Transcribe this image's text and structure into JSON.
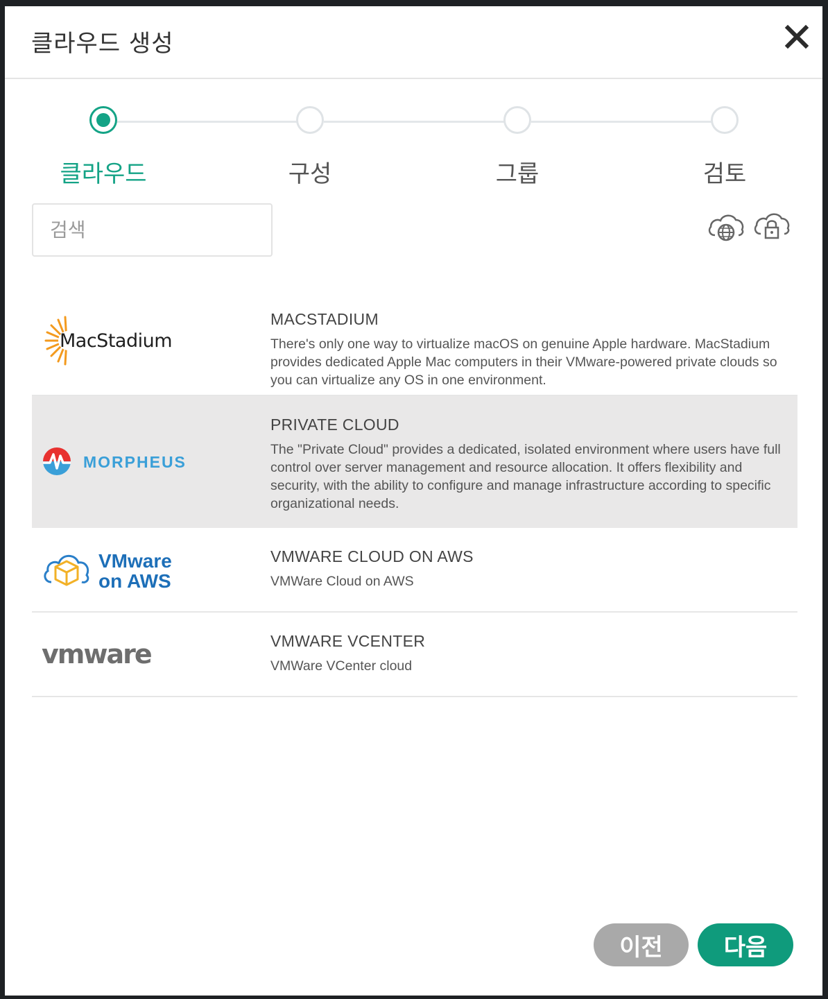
{
  "modal": {
    "title": "클라우드 생성"
  },
  "stepper": {
    "steps": [
      {
        "label": "클라우드",
        "active": true
      },
      {
        "label": "구성",
        "active": false
      },
      {
        "label": "그룹",
        "active": false
      },
      {
        "label": "검토",
        "active": false
      }
    ]
  },
  "search": {
    "placeholder": "검색",
    "value": ""
  },
  "filters": {
    "public_icon": "cloud-globe-icon",
    "private_icon": "cloud-lock-icon"
  },
  "clouds": [
    {
      "logo_text": "MacStadium",
      "logo_icon": "macstadium-sun-logo",
      "title": "MACSTADIUM",
      "description": "There's only one way to virtualize macOS on genuine Apple hardware. MacStadium provides dedicated Apple Mac computers in their VMware-powered private clouds so you can virtualize any OS in one environment."
    },
    {
      "logo_text": "MORPHEUS",
      "logo_icon": "morpheus-logo",
      "title": "PRIVATE CLOUD",
      "description": "The \"Private Cloud\" provides a dedicated, isolated environment where users have full control over server management and resource allocation. It offers flexibility and security, with the ability to configure and manage infrastructure according to specific organizational needs."
    },
    {
      "logo_text_line1": "VMware",
      "logo_text_line2": "on AWS",
      "logo_icon": "vmware-on-aws-logo",
      "title": "VMWARE CLOUD ON AWS",
      "description": "VMWare Cloud on AWS"
    },
    {
      "logo_text": "vmware",
      "logo_icon": "vmware-logo",
      "title": "VMWARE VCENTER",
      "description": "VMWare VCenter cloud"
    }
  ],
  "colors": {
    "accent": "#14a386",
    "next_button": "#0f9b7c",
    "prev_button": "#a9a9a9",
    "selected_row": "#e9e8e8"
  },
  "buttons": {
    "prev_label": "이전",
    "next_label": "다음"
  }
}
